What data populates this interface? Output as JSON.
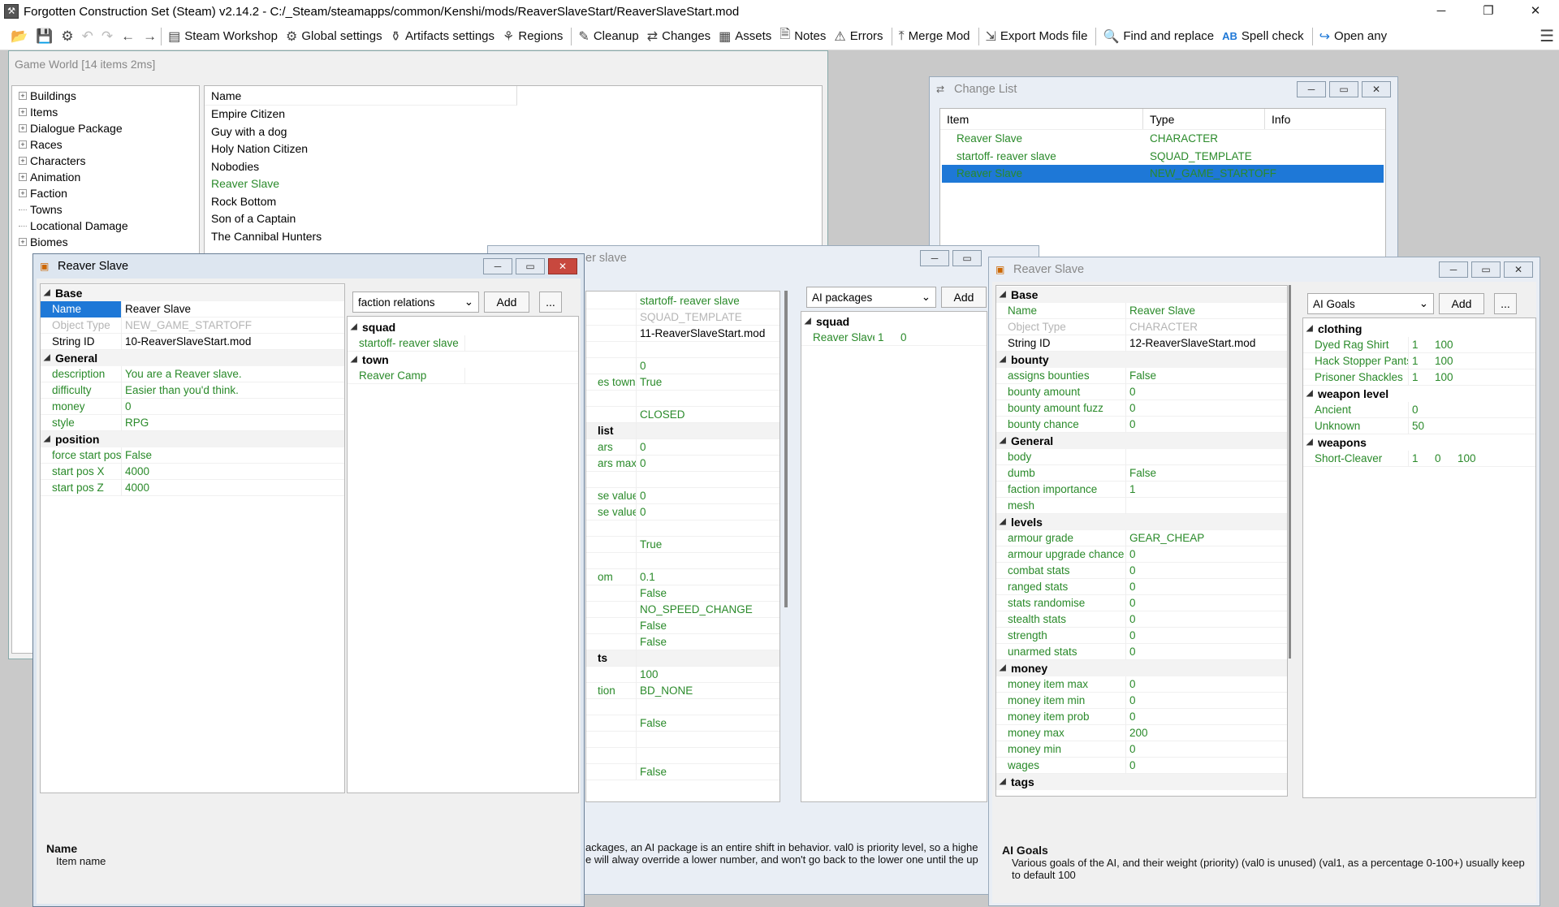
{
  "title": "Forgotten Construction Set (Steam) v2.14.2 - C:/_Steam/steamapps/common/Kenshi/mods/ReaverSlaveStart/ReaverSlaveStart.mod",
  "toolbar": {
    "buttons": [
      "Steam Workshop",
      "Global settings",
      "Artifacts settings",
      "Regions",
      "Cleanup",
      "Changes",
      "Assets",
      "Notes",
      "Errors",
      "Merge Mod",
      "Export Mods file",
      "Find and replace",
      "Spell check",
      "Open any"
    ]
  },
  "gameworld": {
    "title": "Game World [14 items 2ms]",
    "tree": [
      "Buildings",
      "Items",
      "Dialogue Package",
      "Races",
      "Characters",
      "Animation",
      "Faction",
      "Towns",
      "Locational Damage",
      "Biomes"
    ],
    "list_header": "Name",
    "list": [
      "Empire Citizen",
      "Guy with a dog",
      "Holy Nation Citizen",
      "Nobodies",
      "Reaver Slave",
      "Rock Bottom",
      "Son of a Captain",
      "The Cannibal Hunters"
    ]
  },
  "changelist": {
    "title": "Change List",
    "headers": [
      "Item",
      "Type",
      "Info"
    ],
    "rows": [
      [
        "Reaver Slave",
        "CHARACTER"
      ],
      [
        "startoff- reaver slave",
        "SQUAD_TEMPLATE"
      ],
      [
        "Reaver Slave",
        "NEW_GAME_STARTOFF"
      ]
    ]
  },
  "win1": {
    "title": "Reaver Slave",
    "s_base": "Base",
    "s_general": "General",
    "s_position": "position",
    "base": [
      [
        "Name",
        "Reaver Slave"
      ],
      [
        "Object Type",
        "NEW_GAME_STARTOFF"
      ],
      [
        "String ID",
        "10-ReaverSlaveStart.mod"
      ]
    ],
    "general": [
      [
        "description",
        "You are a Reaver slave."
      ],
      [
        "difficulty",
        "Easier than you'd think."
      ],
      [
        "money",
        "0"
      ],
      [
        "style",
        "RPG"
      ]
    ],
    "position": [
      [
        "force start pos",
        "False"
      ],
      [
        "start pos X",
        "4000"
      ],
      [
        "start pos Z",
        "4000"
      ]
    ],
    "dd": "faction relations",
    "add": "Add",
    "more": "...",
    "squad": "squad",
    "squad_item": "startoff- reaver slave",
    "town": "town",
    "town_item": "Reaver Camp",
    "help_title": "Name",
    "help_text": "Item name"
  },
  "win2": {
    "title": "er slave",
    "values": [
      "startoff- reaver slave",
      "SQUAD_TEMPLATE",
      "11-ReaverSlaveStart.mod",
      "",
      "0",
      "True",
      "",
      "CLOSED",
      "",
      "0",
      "0",
      "",
      "0",
      "0",
      "",
      "True",
      "",
      "0.1",
      "False",
      "NO_SPEED_CHANGE",
      "False",
      "False",
      "",
      "100",
      "BD_NONE",
      "",
      "False",
      "",
      "",
      "False"
    ],
    "keys": [
      "",
      "",
      "",
      "",
      "",
      "es towns",
      "",
      "",
      "list",
      "ars",
      "ars max",
      "",
      "se value",
      "se value",
      "",
      "",
      "",
      "om",
      "",
      "",
      "",
      "",
      "ts",
      "",
      "tion",
      "",
      "",
      "",
      "",
      ""
    ],
    "dd": "AI packages",
    "add": "Add",
    "squad": "squad",
    "squad_item": "Reaver Slave",
    "squad_v1": "1",
    "squad_v2": "0",
    "help1": "ackages, an AI package is an entire shift in behavior.  val0 is priority level, so a highe",
    "help2": "e will alway override a lower number, and won't go back to the lower one until the up"
  },
  "win3": {
    "title": "Reaver Slave",
    "s_base": "Base",
    "s_bounty": "bounty",
    "s_general": "General",
    "s_levels": "levels",
    "s_money": "money",
    "s_tags": "tags",
    "base": [
      [
        "Name",
        "Reaver Slave"
      ],
      [
        "Object Type",
        "CHARACTER"
      ],
      [
        "String ID",
        "12-ReaverSlaveStart.mod"
      ]
    ],
    "bounty": [
      [
        "assigns bounties",
        "False"
      ],
      [
        "bounty amount",
        "0"
      ],
      [
        "bounty amount fuzz",
        "0"
      ],
      [
        "bounty chance",
        "0"
      ]
    ],
    "general": [
      [
        "body",
        ""
      ],
      [
        "dumb",
        "False"
      ],
      [
        "faction importance",
        "1"
      ],
      [
        "mesh",
        ""
      ]
    ],
    "levels": [
      [
        "armour grade",
        "GEAR_CHEAP"
      ],
      [
        "armour upgrade chance",
        "0"
      ],
      [
        "combat stats",
        "0"
      ],
      [
        "ranged stats",
        "0"
      ],
      [
        "stats randomise",
        "0"
      ],
      [
        "stealth stats",
        "0"
      ],
      [
        "strength",
        "0"
      ],
      [
        "unarmed stats",
        "0"
      ]
    ],
    "money": [
      [
        "money item max",
        "0"
      ],
      [
        "money item min",
        "0"
      ],
      [
        "money item prob",
        "0"
      ],
      [
        "money max",
        "200"
      ],
      [
        "money min",
        "0"
      ],
      [
        "wages",
        "0"
      ]
    ],
    "dd": "AI Goals",
    "add": "Add",
    "more": "...",
    "s_clothing": "clothing",
    "clothing": [
      [
        "Dyed Rag Shirt",
        "1",
        "100"
      ],
      [
        "Hack Stopper Pants",
        "1",
        "100"
      ],
      [
        "Prisoner Shackles",
        "1",
        "100"
      ]
    ],
    "s_weaponlevel": "weapon level",
    "weaponlevel": [
      [
        "Ancient",
        "0"
      ],
      [
        "Unknown",
        "50"
      ]
    ],
    "s_weapons": "weapons",
    "weapons": [
      [
        "Short-Cleaver",
        "1",
        "0",
        "100"
      ]
    ],
    "help_title": "AI Goals",
    "help_text": "Various goals of the AI, and their weight (priority) (val0 is unused) (val1, as a percentage 0-100+) usually keep to default 100"
  },
  "colors": {
    "accent": "#1e78d7",
    "green": "#2a8a2a"
  }
}
